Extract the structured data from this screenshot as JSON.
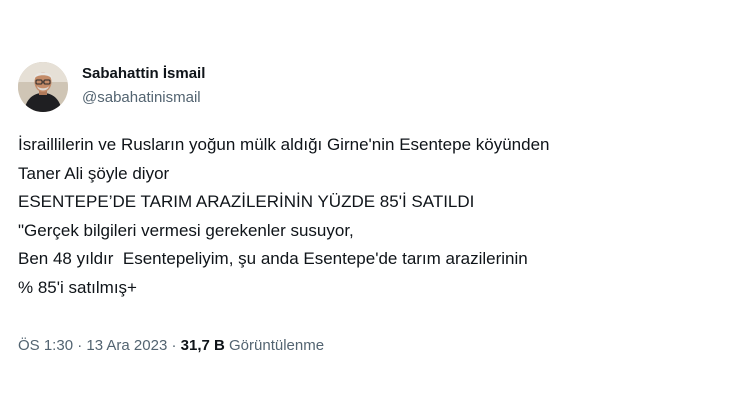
{
  "author": {
    "name": "Sabahattin İsmail",
    "handle": "@sabahatinismail"
  },
  "tweet": {
    "lines": [
      "İsraillilerin ve Rusların yoğun mülk aldığı Girne'nin Esentepe köyünden",
      "Taner Ali şöyle diyor",
      "ESENTEPE’DE TARIM ARAZİLERİNİN YÜZDE 85'İ SATILDI",
      "\"Gerçek bilgileri vermesi gerekenler susuyor,",
      "Ben 48 yıldır  Esentepeliyim, şu anda Esentepe'de tarım arazilerinin",
      "% 85'i satılmış+"
    ]
  },
  "meta": {
    "time": "ÖS 1:30",
    "separator": "·",
    "date": "13 Ara 2023",
    "views_count": "31,7 B",
    "views_label": "Görüntülenme"
  },
  "colors": {
    "text_primary": "#0f1419",
    "text_secondary": "#536471",
    "background": "#ffffff"
  }
}
